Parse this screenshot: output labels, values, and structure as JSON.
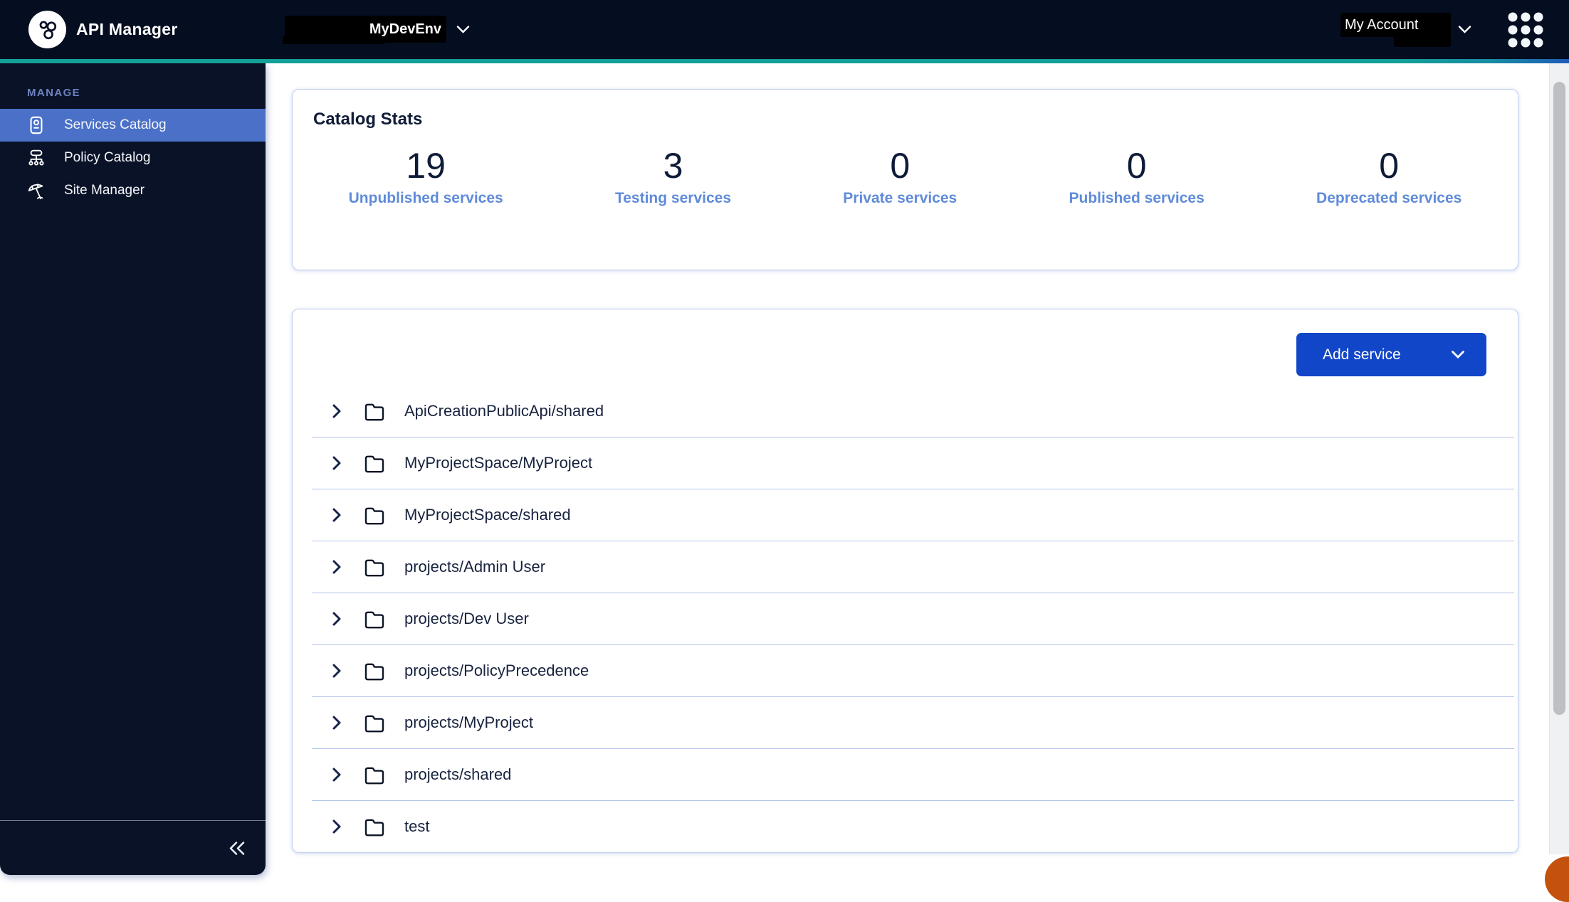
{
  "topbar": {
    "app_title": "API Manager",
    "env_name": "MyDevEnv",
    "account_label": "My Account"
  },
  "sidebar": {
    "section_label": "MANAGE",
    "items": [
      {
        "label": "Services Catalog",
        "selected": true,
        "icon": "badge-card-icon"
      },
      {
        "label": "Policy Catalog",
        "selected": false,
        "icon": "sitemap-icon"
      },
      {
        "label": "Site Manager",
        "selected": false,
        "icon": "beach-umbrella-icon"
      }
    ]
  },
  "catalog_stats": {
    "title": "Catalog Stats",
    "stats": [
      {
        "value": "19",
        "label": "Unpublished services"
      },
      {
        "value": "3",
        "label": "Testing services"
      },
      {
        "value": "0",
        "label": "Private services"
      },
      {
        "value": "0",
        "label": "Published services"
      },
      {
        "value": "0",
        "label": "Deprecated services"
      }
    ]
  },
  "services": {
    "add_button_label": "Add service",
    "folders": [
      {
        "name": "ApiCreationPublicApi/shared"
      },
      {
        "name": "MyProjectSpace/MyProject"
      },
      {
        "name": "MyProjectSpace/shared"
      },
      {
        "name": "projects/Admin User"
      },
      {
        "name": "projects/Dev User"
      },
      {
        "name": "projects/PolicyPrecedence"
      },
      {
        "name": "projects/MyProject"
      },
      {
        "name": "projects/shared"
      },
      {
        "name": "test"
      }
    ]
  },
  "icons": {
    "logo": "api-nodes-icon",
    "apps": "apps-grid-icon",
    "env_dropdown": "chevron-down-icon",
    "account_dropdown": "chevron-down-icon",
    "row_expand": "chevron-right-icon",
    "row_type": "folder-icon",
    "sidebar_collapse": "double-chevron-left-icon"
  },
  "colors": {
    "topbar_bg": "#050D21",
    "sidebar_bg": "#0A1228",
    "selected_item": "#4A70C8",
    "accent_teal": "#13A096",
    "accent_blue_end": "#1D5BB7",
    "primary_button": "#1246C8",
    "stat_label": "#5F8BD9",
    "dark_text": "#101C38",
    "divider": "#AFC2E8",
    "fab_orange": "#C4520E"
  }
}
